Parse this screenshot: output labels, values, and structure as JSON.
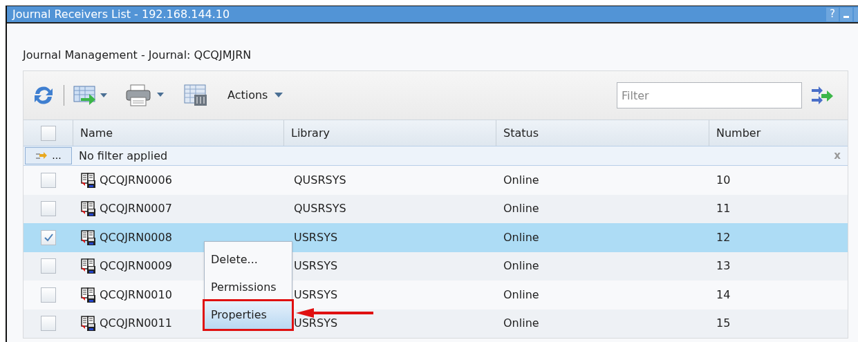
{
  "window": {
    "title": "Journal Receivers List - 192.168.144.10",
    "help": "?"
  },
  "heading": "Journal Management - Journal: QCQJMJRN",
  "toolbar": {
    "actions": "Actions",
    "filter": {
      "placeholder": "Filter"
    }
  },
  "table": {
    "columns": [
      "Name",
      "Library",
      "Status",
      "Number"
    ],
    "filter_row": {
      "button": "...",
      "text": "No filter applied",
      "clear": "x"
    },
    "select_all": {
      "checked": false
    },
    "rows": [
      {
        "name": "QCQJRN0006",
        "library": "QUSRSYS",
        "status": "Online",
        "number": "10",
        "selected": false
      },
      {
        "name": "QCQJRN0007",
        "library": "QUSRSYS",
        "status": "Online",
        "number": "11",
        "selected": false
      },
      {
        "name": "QCQJRN0008",
        "library": "USRSYS",
        "status": "Online",
        "number": "12",
        "selected": true
      },
      {
        "name": "QCQJRN0009",
        "library": "USRSYS",
        "status": "Online",
        "number": "13",
        "selected": false
      },
      {
        "name": "QCQJRN0010",
        "library": "USRSYS",
        "status": "Online",
        "number": "14",
        "selected": false
      },
      {
        "name": "QCQJRN0011",
        "library": "USRSYS",
        "status": "Online",
        "number": "15",
        "selected": false
      }
    ]
  },
  "context_menu": {
    "items": [
      {
        "label": "Delete...",
        "highlighted": false
      },
      {
        "label": "Permissions",
        "highlighted": false
      },
      {
        "label": "Properties",
        "highlighted": true
      }
    ]
  }
}
